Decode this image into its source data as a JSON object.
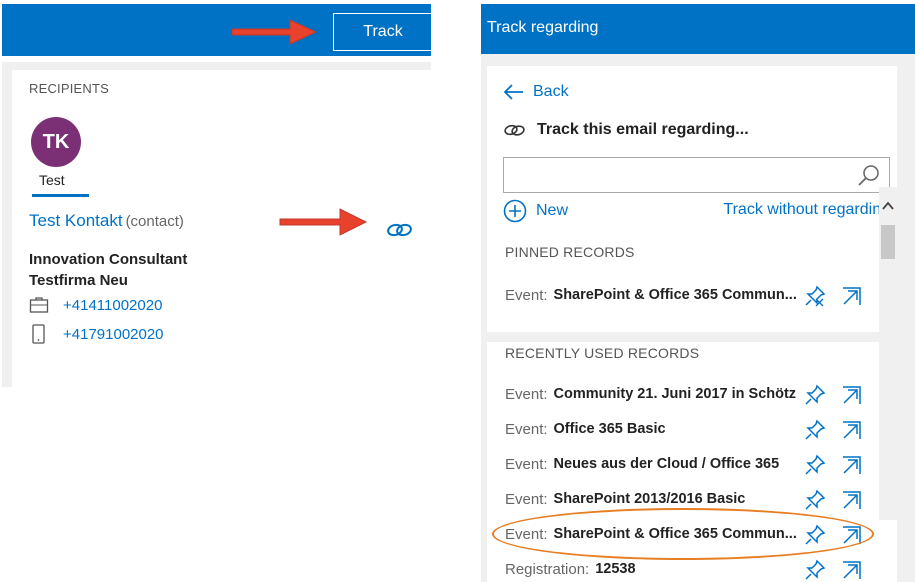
{
  "left": {
    "track_button": "Track",
    "recipients_title": "RECIPIENTS",
    "avatar_initials": "TK",
    "avatar_name": "Test",
    "contact_name": "Test Kontakt",
    "contact_type": "(contact)",
    "job_title": "Innovation Consultant",
    "company": "Testfirma Neu",
    "phone_business": "+41411002020",
    "phone_mobile": "+41791002020"
  },
  "right": {
    "header_title": "Track regarding",
    "back_label": "Back",
    "heading": "Track this email regarding...",
    "search_placeholder": "",
    "new_label": "New",
    "track_without_label": "Track without regarding",
    "pinned_title": "PINNED RECORDS",
    "pinned": [
      {
        "type": "Event:",
        "name": "SharePoint & Office 365 Commun..."
      }
    ],
    "recent_title": "RECENTLY USED RECORDS",
    "recent": [
      {
        "type": "Event:",
        "name": "Community 21. Juni 2017 in Schötz"
      },
      {
        "type": "Event:",
        "name": "Office 365 Basic"
      },
      {
        "type": "Event:",
        "name": "Neues aus der Cloud / Office 365"
      },
      {
        "type": "Event:",
        "name": "SharePoint 2013/2016 Basic"
      },
      {
        "type": "Event:",
        "name": "SharePoint & Office 365 Commun..."
      },
      {
        "type": "Registration:",
        "name": "12538"
      }
    ]
  },
  "colors": {
    "accent": "#0072c6",
    "avatar": "#7b3076",
    "arrow": "#e8412c",
    "highlight": "#e67e22"
  }
}
